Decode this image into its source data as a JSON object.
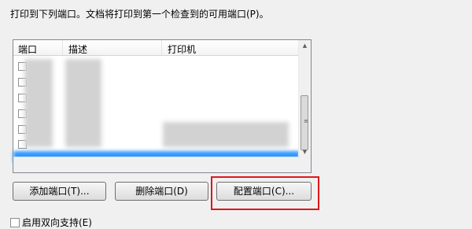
{
  "instruction": "打印到下列端口。文档将打印到第一个检查到的可用端口(P)。",
  "port_list": {
    "columns": [
      "端口",
      "描述",
      "打印机"
    ]
  },
  "buttons": {
    "add_port": "添加端口(T)...",
    "delete_port": "删除端口(D)",
    "configure_port": "配置端口(C)..."
  },
  "bidirectional_label": "启用双向支持(E)"
}
